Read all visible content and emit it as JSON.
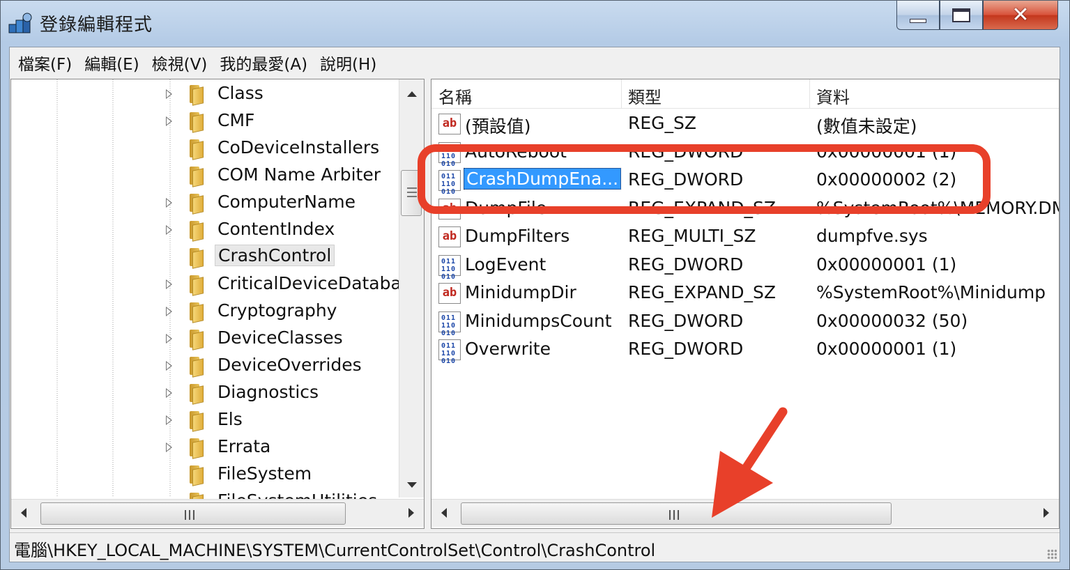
{
  "window": {
    "title": "登錄編輯程式",
    "close_glyph": "✕"
  },
  "menu": [
    "檔案(F)",
    "編輯(E)",
    "檢視(V)",
    "我的最愛(A)",
    "說明(H)"
  ],
  "tree": {
    "items": [
      {
        "label": "Class",
        "expandable": true
      },
      {
        "label": "CMF",
        "expandable": true
      },
      {
        "label": "CoDeviceInstallers",
        "expandable": false
      },
      {
        "label": "COM Name Arbiter",
        "expandable": false
      },
      {
        "label": "ComputerName",
        "expandable": true
      },
      {
        "label": "ContentIndex",
        "expandable": true
      },
      {
        "label": "CrashControl",
        "expandable": false,
        "selected": true
      },
      {
        "label": "CriticalDeviceDatabase",
        "expandable": true
      },
      {
        "label": "Cryptography",
        "expandable": true
      },
      {
        "label": "DeviceClasses",
        "expandable": true
      },
      {
        "label": "DeviceOverrides",
        "expandable": true
      },
      {
        "label": "Diagnostics",
        "expandable": true
      },
      {
        "label": "Els",
        "expandable": true
      },
      {
        "label": "Errata",
        "expandable": true
      },
      {
        "label": "FileSystem",
        "expandable": false
      },
      {
        "label": "FileSystemUtilities",
        "expandable": false
      }
    ]
  },
  "list": {
    "columns": [
      "名稱",
      "類型",
      "資料"
    ],
    "rows": [
      {
        "icon": "ab",
        "name": "(預設值)",
        "type": "REG_SZ",
        "data": "(數值未設定)"
      },
      {
        "icon": "bin",
        "name": "AutoReboot",
        "type": "REG_DWORD",
        "data": "0x00000001 (1)"
      },
      {
        "icon": "bin",
        "name": "CrashDumpEna...",
        "type": "REG_DWORD",
        "data": "0x00000002 (2)",
        "selected": true
      },
      {
        "icon": "ab",
        "name": "DumpFile",
        "type": "REG_EXPAND_SZ",
        "data": "%SystemRoot%\\MEMORY.DMP"
      },
      {
        "icon": "ab",
        "name": "DumpFilters",
        "type": "REG_MULTI_SZ",
        "data": "dumpfve.sys"
      },
      {
        "icon": "bin",
        "name": "LogEvent",
        "type": "REG_DWORD",
        "data": "0x00000001 (1)"
      },
      {
        "icon": "ab",
        "name": "MinidumpDir",
        "type": "REG_EXPAND_SZ",
        "data": "%SystemRoot%\\Minidump"
      },
      {
        "icon": "bin",
        "name": "MinidumpsCount",
        "type": "REG_DWORD",
        "data": "0x00000032 (50)"
      },
      {
        "icon": "bin",
        "name": "Overwrite",
        "type": "REG_DWORD",
        "data": "0x00000001 (1)"
      }
    ]
  },
  "statusbar": {
    "path": "電腦\\HKEY_LOCAL_MACHINE\\SYSTEM\\CurrentControlSet\\Control\\CrashControl"
  },
  "icons": {
    "string_value": "ab",
    "binary_value": "011 110 010"
  },
  "colors": {
    "annotation": "#e8402a",
    "selection": "#3399ff"
  }
}
